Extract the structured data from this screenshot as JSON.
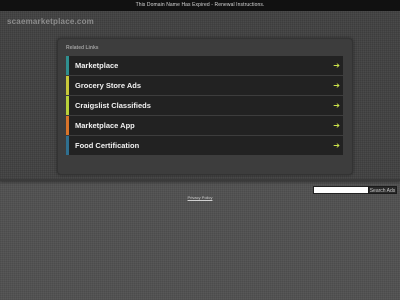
{
  "top_bar": {
    "notice": "This Domain Name Has Expired - Renewal Instructions."
  },
  "header": {
    "site_title": "scaemarketplace.com"
  },
  "related_links": {
    "heading": "Related Links",
    "arrow_glyph": "➔",
    "items": [
      {
        "label": "Marketplace",
        "accent_color": "#2f8f8f"
      },
      {
        "label": "Grocery Store Ads",
        "accent_color": "#c8c83a"
      },
      {
        "label": "Craigslist Classifieds",
        "accent_color": "#b9d13a"
      },
      {
        "label": "Marketplace App",
        "accent_color": "#d9742a"
      },
      {
        "label": "Food Certification",
        "accent_color": "#2f6f8f"
      }
    ],
    "arrow_color": "#c8e04a"
  },
  "search": {
    "input_value": "",
    "button_label": "Search Ads"
  },
  "footer": {
    "privacy_label": "Privacy Policy"
  }
}
